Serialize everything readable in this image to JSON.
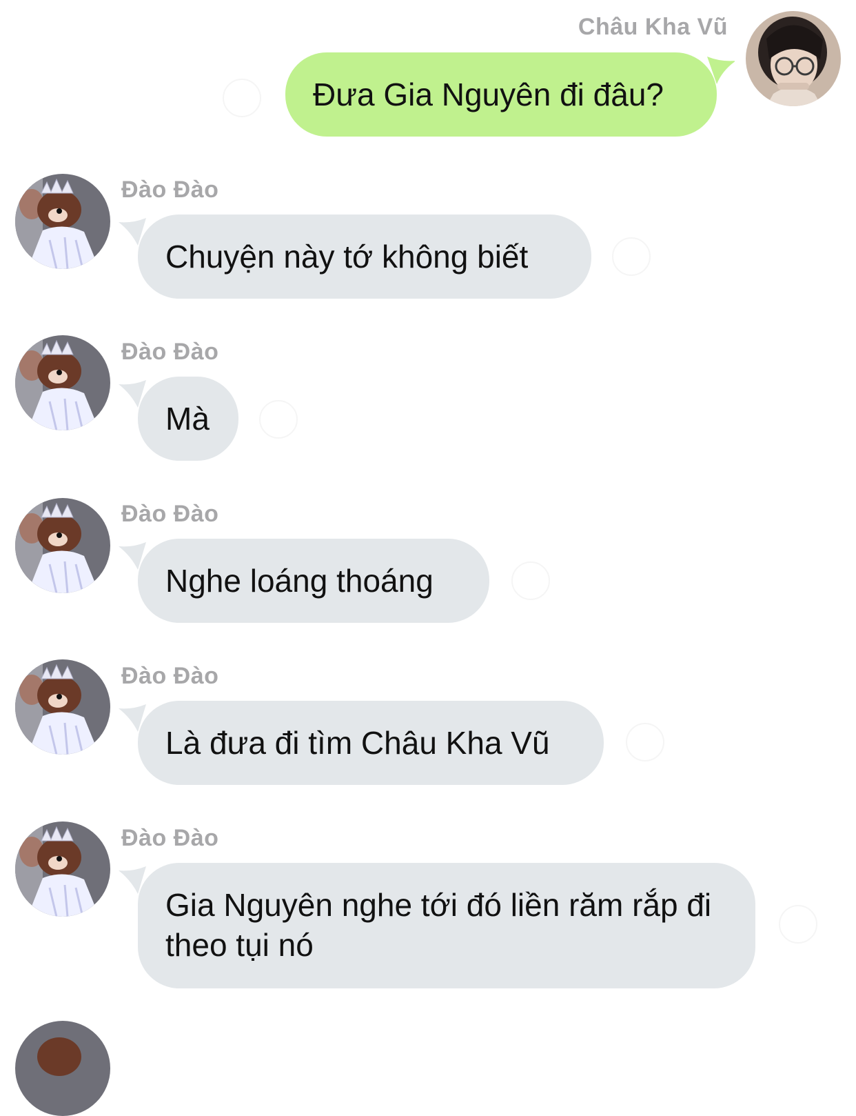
{
  "conversation": {
    "outgoing": {
      "sender": "Châu Kha Vũ",
      "text": "Đưa Gia Nguyên đi đâu?",
      "avatar_icon": "user-photo-avatar",
      "bubble_color": "#c0f18e"
    },
    "incoming_sender": "Đào Đào",
    "incoming_avatar_icon": "jerry-mouse-princess-avatar",
    "incoming_bubble_color": "#e3e7ea",
    "messages": [
      {
        "sender": "Đào Đào",
        "text": "Chuyện này tớ không biết"
      },
      {
        "sender": "Đào Đào",
        "text": "Mà"
      },
      {
        "sender": "Đào Đào",
        "text": "Nghe loáng thoáng"
      },
      {
        "sender": "Đào Đào",
        "text": "Là đưa đi tìm Châu Kha Vũ"
      },
      {
        "sender": "Đào Đào",
        "text": "Gia Nguyên nghe tới đó liền răm rắp đi theo tụi nó"
      }
    ]
  }
}
